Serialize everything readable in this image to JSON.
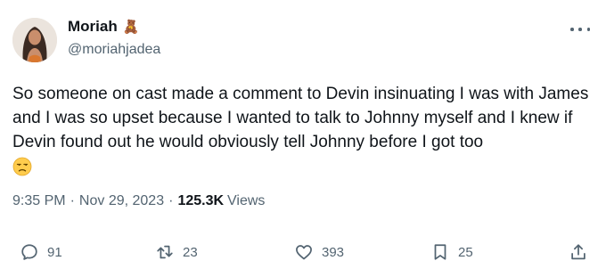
{
  "author": {
    "display_name": "Moriah",
    "name_emoji": "🧸",
    "handle": "@moriahjadea"
  },
  "tweet": {
    "text": "So someone on cast made a comment to Devin insinuating I was with James and I was so upset because I wanted to talk to Johnny myself and I knew if Devin found out he would obviously tell Johnny before I got too",
    "trailing_emoji": "😒"
  },
  "meta": {
    "time": "9:35 PM",
    "separator": "·",
    "date": "Nov 29, 2023",
    "views_count": "125.3K",
    "views_label": "Views"
  },
  "actions": {
    "replies": "91",
    "reposts": "23",
    "likes": "393",
    "bookmarks": "25"
  },
  "icons": {
    "more": "more-horizontal-icon",
    "reply": "reply-icon",
    "repost": "repost-icon",
    "like": "heart-icon",
    "bookmark": "bookmark-icon",
    "share": "share-icon"
  },
  "colors": {
    "text": "#0f1419",
    "secondary": "#536471"
  }
}
